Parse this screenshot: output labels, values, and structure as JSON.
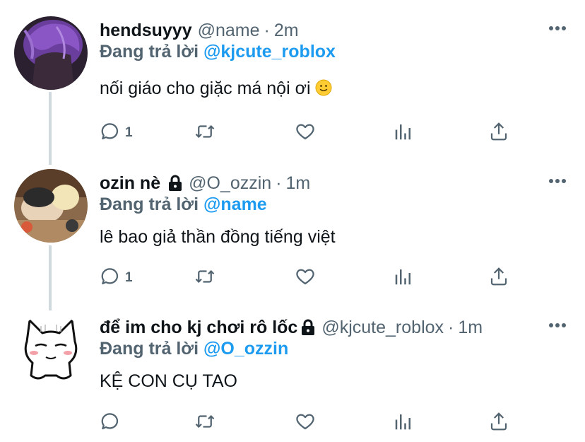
{
  "tweets": [
    {
      "display_name": "hendsuyyy",
      "handle": "@name",
      "separator": "·",
      "time": "2m",
      "replying_label": "Đang trả lời",
      "replying_to": "@kjcute_roblox",
      "text": "nối giáo cho giặc má nội ơi",
      "emoji": "slightly-smiling-face",
      "reply_count": "1",
      "locked": false
    },
    {
      "display_name": "ozin nè",
      "handle": "@O_ozzin",
      "separator": "·",
      "time": "1m",
      "replying_label": "Đang trả lời",
      "replying_to": "@name",
      "text": "lê bao giả thần đồng tiếng việt",
      "reply_count": "1",
      "locked": true
    },
    {
      "display_name": "để im cho kj chơi rô lốc",
      "handle": "@kjcute_roblox",
      "separator": "·",
      "time": "1m",
      "replying_label": "Đang trả lời",
      "replying_to": "@O_ozzin",
      "text": "KỆ CON CỤ TAO",
      "reply_count": "",
      "locked": true
    }
  ],
  "colors": {
    "accent": "#1d9bf0",
    "secondary_text": "#536471",
    "thread_line": "#cfd9de",
    "icon": "#536471"
  },
  "icons": [
    "reply-icon",
    "retweet-icon",
    "like-icon",
    "analytics-icon",
    "share-icon",
    "more-icon",
    "lock-icon"
  ]
}
